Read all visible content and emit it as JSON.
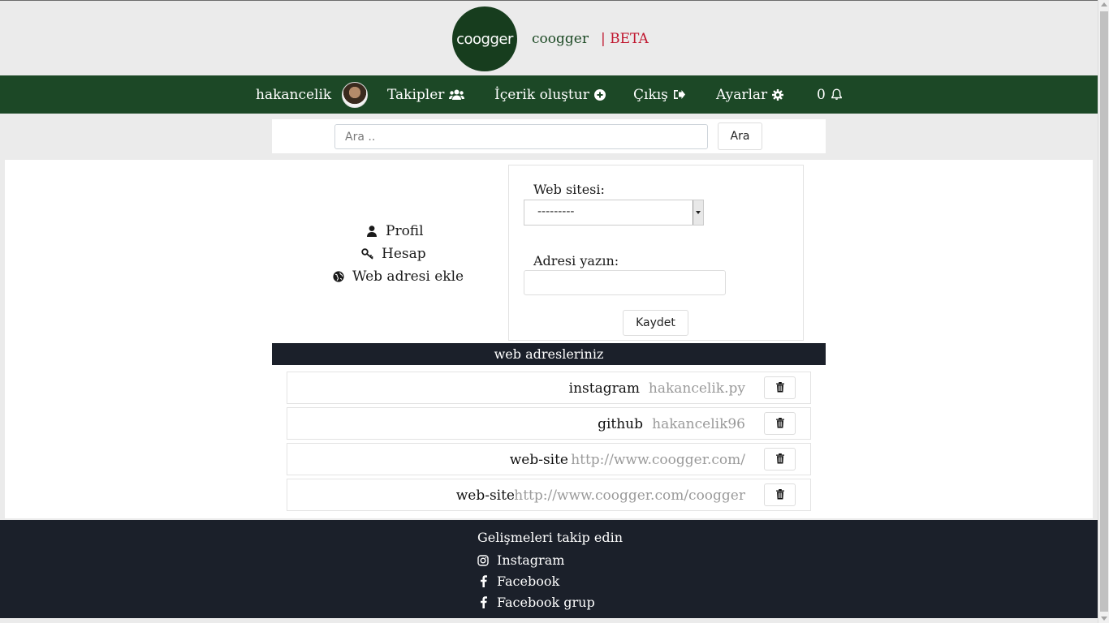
{
  "brand": {
    "logo_text": "coogger",
    "name": "coogger",
    "beta": "| BETA"
  },
  "nav": {
    "username": "hakancelik",
    "followers": "Takipler",
    "create": "İçerik oluştur",
    "logout": "Çıkış",
    "settings": "Ayarlar",
    "notifications_count": "0"
  },
  "search": {
    "placeholder": "Ara ..",
    "button": "Ara"
  },
  "side_menu": {
    "profile": "Profil",
    "account": "Hesap",
    "add_web": "Web adresi ekle"
  },
  "form": {
    "site_label": "Web sitesi:",
    "site_selected": "---------",
    "address_label": "Adresi yazın:",
    "address_value": "",
    "save": "Kaydet"
  },
  "list": {
    "title": "web adresleriniz",
    "items": [
      {
        "site": "instagram",
        "address": "hakancelik.py"
      },
      {
        "site": "github",
        "address": "hakancelik96"
      },
      {
        "site": "web-site",
        "address": "http://www.coogger.com/"
      },
      {
        "site": "web-site",
        "address": "http://www.coogger.com/coogger"
      }
    ]
  },
  "footer": {
    "title": "Gelişmeleri takip edin",
    "links": [
      "Instagram",
      "Facebook",
      "Facebook grup"
    ]
  },
  "colors": {
    "nav_bg": "#1c4826",
    "logo_bg": "#173d1e",
    "beta": "#c0172f",
    "dark_bg": "#1b202a"
  }
}
